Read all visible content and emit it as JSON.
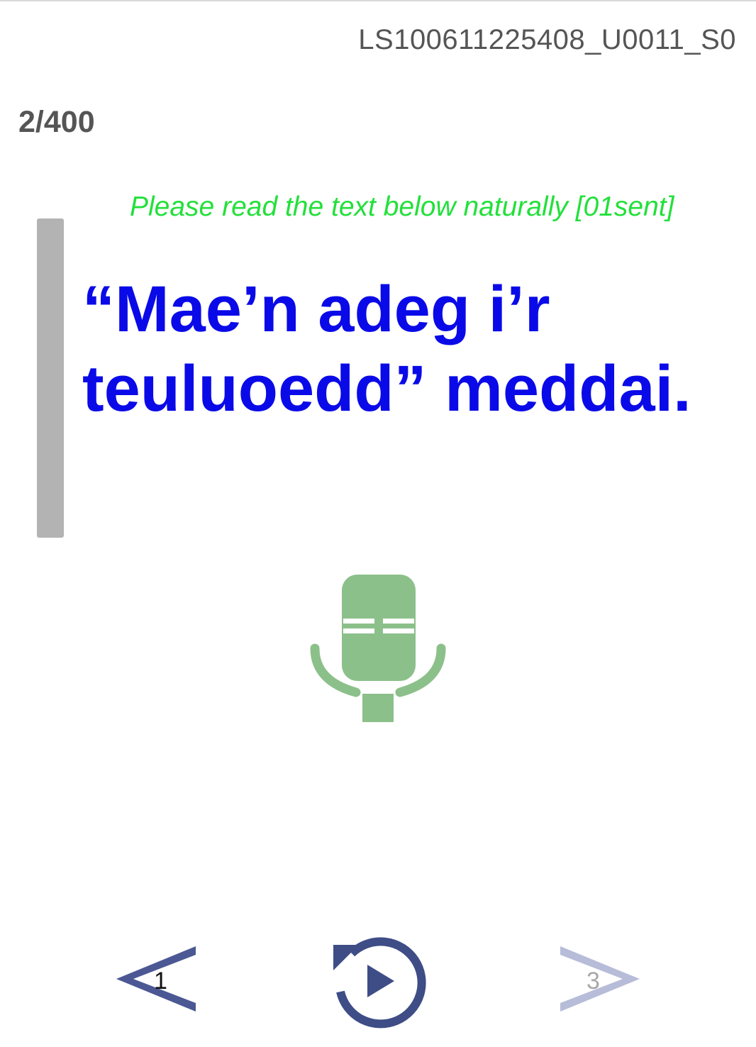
{
  "header": {
    "session_id": "LS100611225408_U0011_S0",
    "progress": "2/400"
  },
  "instruction": "Please read the text below naturally [01sent]",
  "prompt": {
    "text": "“Mae’n adeg i’r teuluoedd” meddai."
  },
  "controls": {
    "mic_icon": "microphone-icon",
    "replay_icon": "replay-play-icon",
    "prev_label": "1",
    "next_label": "3"
  },
  "colors": {
    "prompt_text": "#0a0ae8",
    "instruction_text": "#22e03a",
    "mic": "#8cc08a",
    "nav_active": "#4b5894",
    "nav_disabled": "#b7bcd8",
    "replay": "#3e4d86"
  }
}
